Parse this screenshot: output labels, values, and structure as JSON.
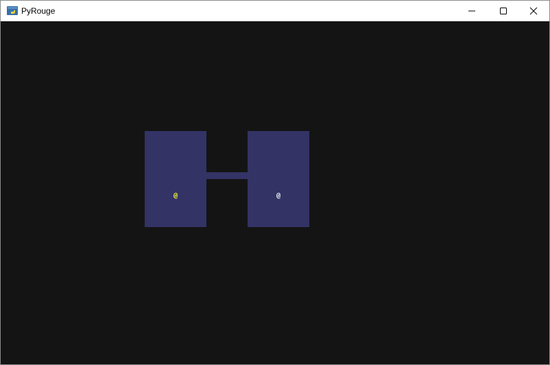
{
  "window": {
    "title": "PyRouge",
    "icon": "python-icon",
    "controls": [
      "minimize-icon",
      "maximize-icon",
      "close-icon"
    ]
  },
  "map": {
    "background_color": "#141414",
    "floor_color": "#333366",
    "entities": [
      {
        "name": "player",
        "glyph": "@",
        "color": "#ffff33"
      },
      {
        "name": "npc",
        "glyph": "@",
        "color": "#ffffff"
      }
    ]
  }
}
